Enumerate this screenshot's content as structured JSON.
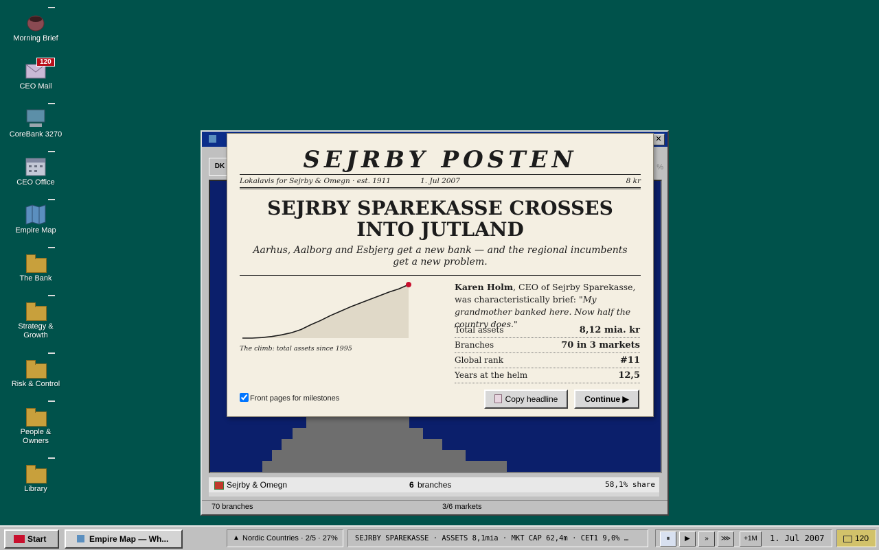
{
  "desktop": {
    "icons": [
      {
        "label": "Morning Brief"
      },
      {
        "label": "CEO Mail",
        "badge": "120"
      },
      {
        "label": "CoreBank 3270"
      },
      {
        "label": "CEO Office"
      },
      {
        "label": "Empire Map"
      },
      {
        "label": "The Bank"
      },
      {
        "label": "Strategy & Growth"
      },
      {
        "label": "Risk & Control"
      },
      {
        "label": "People & Owners"
      },
      {
        "label": "Library"
      }
    ]
  },
  "bg_window": {
    "tab": "DK",
    "row_name": "Sejrby & Omegn",
    "row_count": "6",
    "row_count_label": "branches",
    "row_share": "58,1% share",
    "status_left": "70 branches",
    "status_right": "3/6 markets"
  },
  "newspaper": {
    "masthead": "SEJRBY POSTEN",
    "tagline": "Lokalavis for Sejrby & Omegn · est. 1911",
    "date": "1. Jul 2007",
    "price": "8 kr",
    "headline": "SEJRBY SPAREKASSE CROSSES INTO JUTLAND",
    "subhead": "Aarhus, Aalborg and Esbjerg get a new bank — and the regional incumbents get a new problem.",
    "chart_caption": "The climb: total assets since 1995",
    "story_name": "Karen Holm",
    "story_role": ", CEO of Sejrby Sparekasse, was characteristically brief: ",
    "story_quote": "\"My grandmother banked here. Now half the country does.\"",
    "stats": [
      {
        "label": "Total assets",
        "value": "8,12 mia. kr"
      },
      {
        "label": "Branches",
        "value": "70 in 3 markets"
      },
      {
        "label": "Global rank",
        "value": "#11"
      },
      {
        "label": "Years at the helm",
        "value": "12,5"
      }
    ],
    "checkbox_label": "Front pages for milestones",
    "copy_button": "Copy headline",
    "continue_button": "Continue ▶"
  },
  "chart_data": {
    "type": "area",
    "values": [
      0.0,
      0.0,
      0.01,
      0.03,
      0.06,
      0.1,
      0.16,
      0.25,
      0.33,
      0.42,
      0.5,
      0.58,
      0.65,
      0.72,
      0.79,
      0.86,
      0.92,
      1.0
    ],
    "highlight_last_point": true,
    "title": "",
    "xlabel": "",
    "ylabel": ""
  },
  "taskbar": {
    "start_label": "Start",
    "active_window": "Empire Map — Wh...",
    "region": "Nordic Countries · 2/5 · 27%",
    "ticker": "SEJRBY SPAREKASSE · ASSETS 8,1mia · MKT CAP 62,4m · CET1 9,0% …",
    "pause": "⏸",
    "play": "▶",
    "fast": "»",
    "faster": "⋙",
    "plus_month": "+1M",
    "date": "1. Jul 2007",
    "mail_count": "120"
  }
}
